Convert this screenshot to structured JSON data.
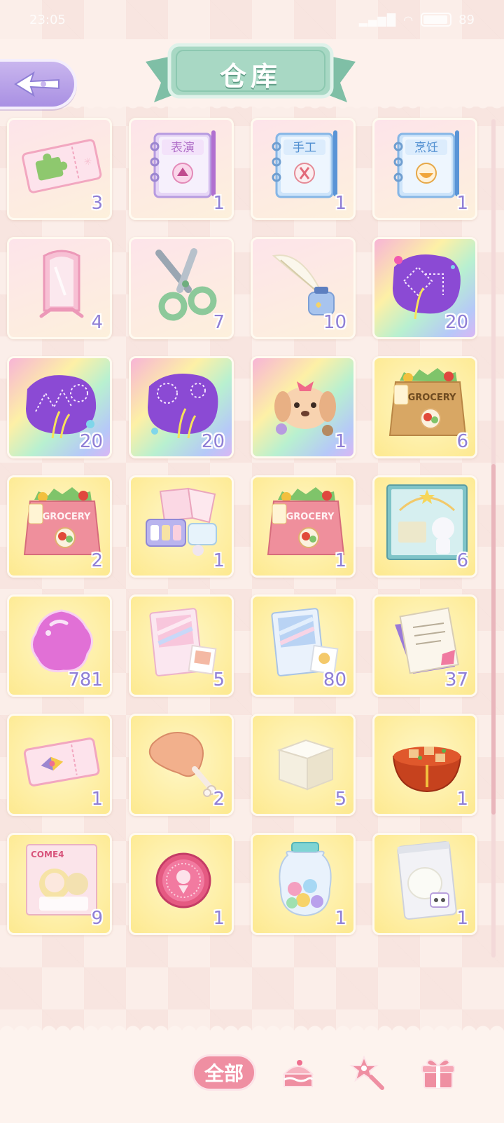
{
  "status_bar": {
    "time": "23:05",
    "battery": "89"
  },
  "header": {
    "title": "仓库"
  },
  "items": [
    {
      "name": "puzzle-ticket",
      "count": "3"
    },
    {
      "name": "performance-notebook",
      "count": "1",
      "label": "表演"
    },
    {
      "name": "craft-notebook",
      "count": "1",
      "label": "手工"
    },
    {
      "name": "cooking-notebook",
      "count": "1",
      "label": "烹饪"
    },
    {
      "name": "pink-mirror",
      "count": "4"
    },
    {
      "name": "scissors",
      "count": "7"
    },
    {
      "name": "quill-and-ink",
      "count": "10"
    },
    {
      "name": "firework-card-1",
      "count": "20"
    },
    {
      "name": "firework-card-2",
      "count": "20"
    },
    {
      "name": "firework-card-3",
      "count": "20"
    },
    {
      "name": "puppy-card",
      "count": "1"
    },
    {
      "name": "grocery-bag-brown",
      "count": "6",
      "label": "GROCERY"
    },
    {
      "name": "grocery-bag-pink",
      "count": "2",
      "label": "GROCERY"
    },
    {
      "name": "makeup-kit",
      "count": "1"
    },
    {
      "name": "grocery-bag-pink-2",
      "count": "1",
      "label": "GROCERY"
    },
    {
      "name": "teal-poster",
      "count": "6"
    },
    {
      "name": "pink-gem",
      "count": "781"
    },
    {
      "name": "photo-pack-pink",
      "count": "5"
    },
    {
      "name": "photo-pack-blue",
      "count": "80"
    },
    {
      "name": "scroll-document",
      "count": "37"
    },
    {
      "name": "bow-ticket",
      "count": "1"
    },
    {
      "name": "chicken-leg",
      "count": "2"
    },
    {
      "name": "tofu",
      "count": "5"
    },
    {
      "name": "mapo-tofu-bowl",
      "count": "1"
    },
    {
      "name": "sticker-pack",
      "count": "9",
      "label": "COME4"
    },
    {
      "name": "pink-badge",
      "count": "1"
    },
    {
      "name": "candy-jar",
      "count": "1"
    },
    {
      "name": "flour-bag",
      "count": "1"
    }
  ],
  "bottom_tabs": {
    "all_label": "全部"
  },
  "colors": {
    "accent_pink": "#ef8fa2",
    "count_purple": "#8f7fd6",
    "ribbon_teal": "#a8d8c4"
  }
}
